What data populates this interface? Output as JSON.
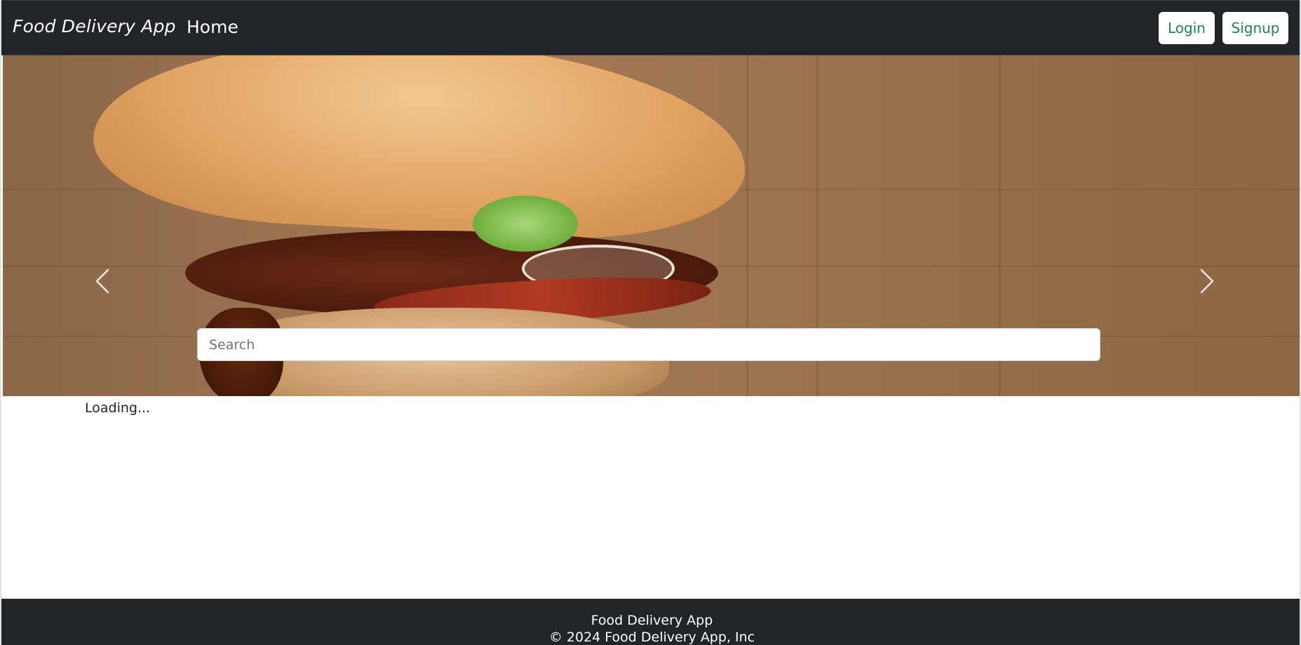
{
  "navbar": {
    "brand": "Food Delivery App",
    "home_label": "Home",
    "login_label": "Login",
    "signup_label": "Signup"
  },
  "hero": {
    "image_subject": "chicken burger with bacon, lettuce and sauce on wooden board",
    "prev_icon": "chevron-left-icon",
    "next_icon": "chevron-right-icon"
  },
  "search": {
    "placeholder": "Search",
    "value": ""
  },
  "status": {
    "loading_text": "Loading..."
  },
  "footer": {
    "title": "Food Delivery App",
    "copyright": "© 2024 Food Delivery App, Inc"
  },
  "colors": {
    "navbar_bg": "#212529",
    "button_text": "#198754",
    "footer_bg": "#212529"
  }
}
